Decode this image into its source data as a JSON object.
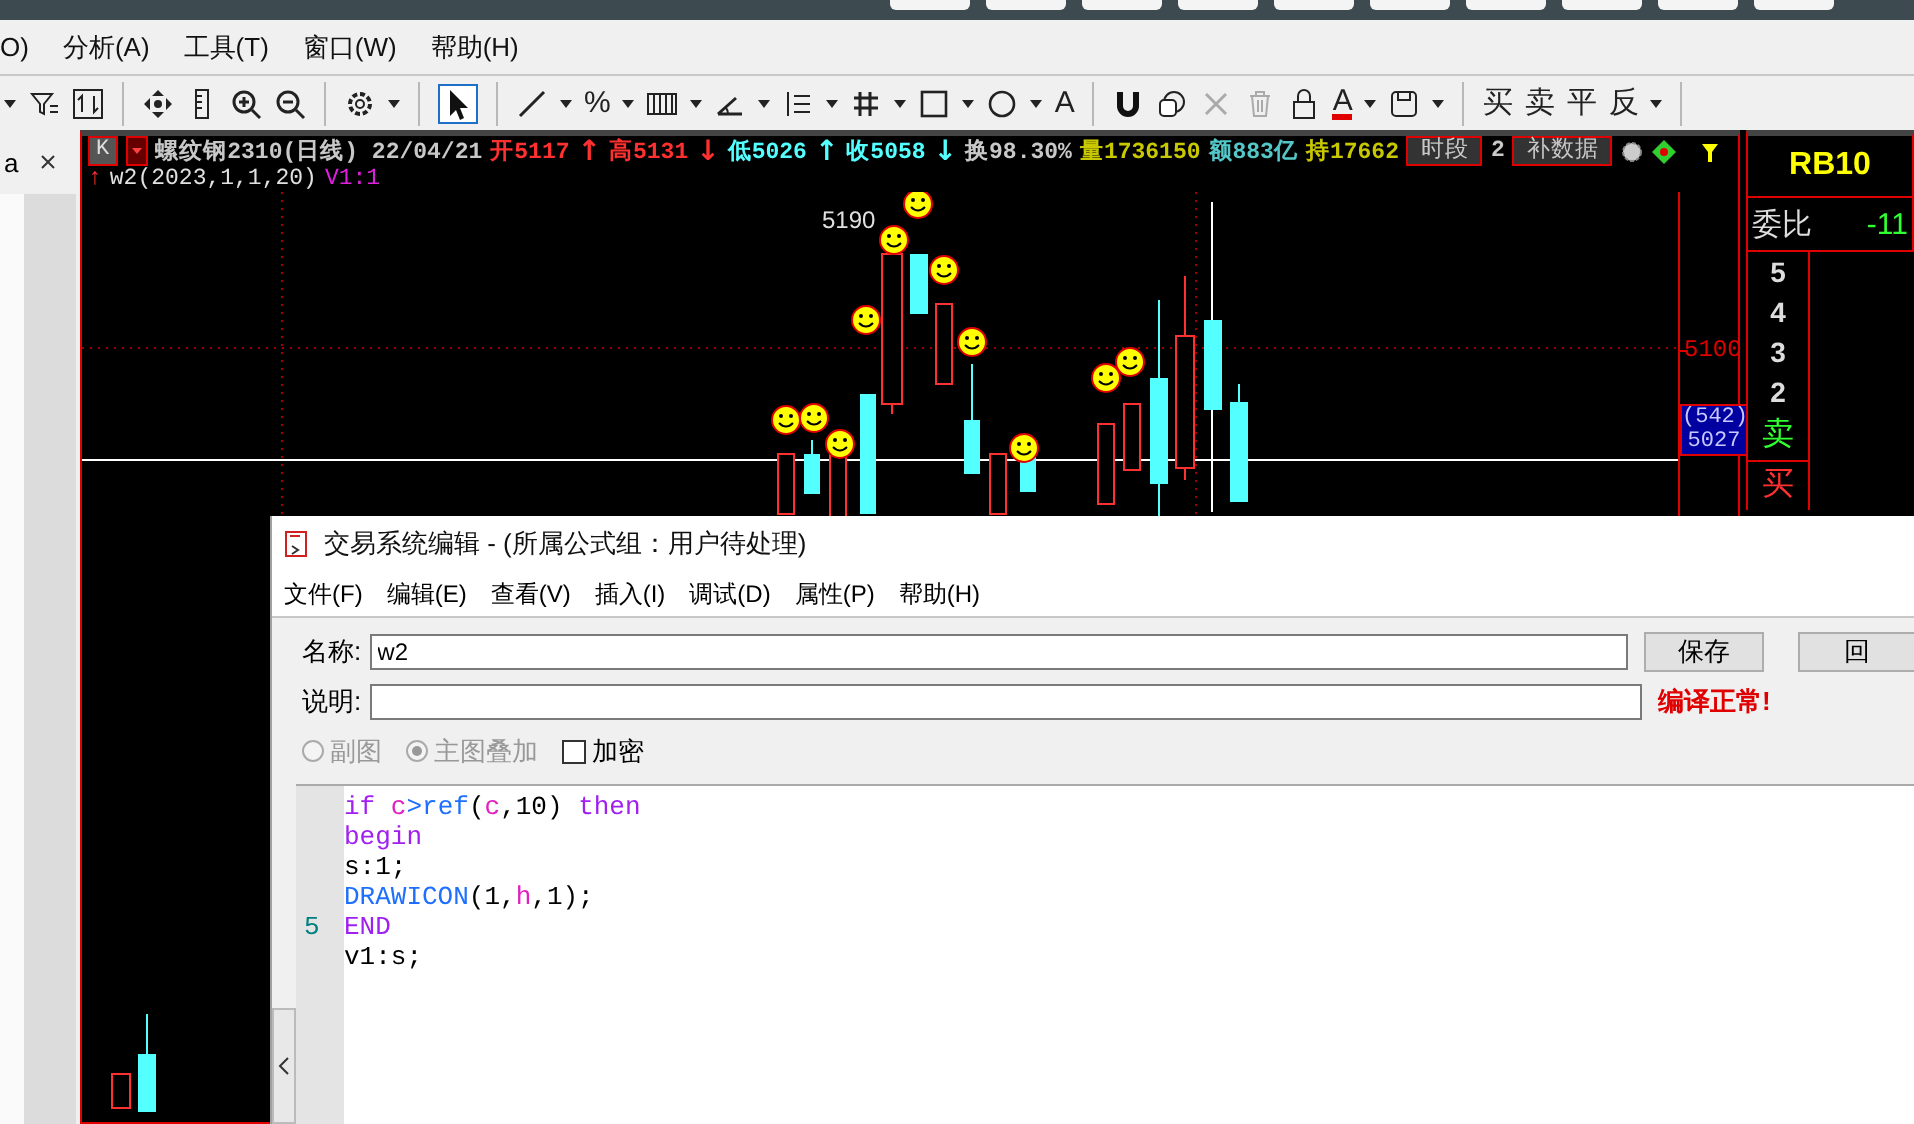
{
  "menu": [
    {
      "label": "O)"
    },
    {
      "label": "分析(A)"
    },
    {
      "label": "工具(T)"
    },
    {
      "label": "窗口(W)"
    },
    {
      "label": "帮助(H)"
    }
  ],
  "toolbar": {
    "labels": [
      "%",
      "A",
      "A",
      "买",
      "卖",
      "平",
      "反"
    ]
  },
  "left_panel": {
    "tab_label": "a"
  },
  "chart": {
    "period_button": "K",
    "quote_items": [
      {
        "kind": "text",
        "text": "螺纹钢2310(日线) 22/04/21",
        "color": "#c8c8c8"
      },
      {
        "kind": "text",
        "text": "开5117",
        "color": "#ff3030"
      },
      {
        "kind": "arrow",
        "text": "↑",
        "color": "#ff3030"
      },
      {
        "kind": "text",
        "text": "高5131",
        "color": "#ff3030"
      },
      {
        "kind": "arrow",
        "text": "↓",
        "color": "#ff3030"
      },
      {
        "kind": "text",
        "text": "低5026",
        "color": "#54ffff"
      },
      {
        "kind": "arrow",
        "text": "↑",
        "color": "#54ffff"
      },
      {
        "kind": "text",
        "text": "收5058",
        "color": "#54ffff"
      },
      {
        "kind": "arrow",
        "text": "↓",
        "color": "#54ffff"
      },
      {
        "kind": "text",
        "text": "换98.30%",
        "color": "#c8c8c8"
      },
      {
        "kind": "text",
        "text": "量1736150",
        "color": "#c8c800"
      },
      {
        "kind": "text",
        "text": "额883亿",
        "color": "#54c8c8"
      },
      {
        "kind": "text",
        "text": "持17662",
        "color": "#c8c800"
      },
      {
        "kind": "button",
        "text": "时段"
      },
      {
        "kind": "text",
        "text": "2",
        "color": "#c8c8c8"
      },
      {
        "kind": "button",
        "text": "补数据"
      }
    ],
    "indicator": {
      "arrow": "↑",
      "label": "w2(2023,1,1,20)",
      "value": "V1:1"
    },
    "peak_label": "5190",
    "axis_label": "5100",
    "crosshair": {
      "count": "(542)",
      "price": "5027"
    }
  },
  "quote_panel": {
    "symbol": "RB10",
    "ratio_label": "委比",
    "ratio_value": "-11",
    "levels": [
      "5",
      "4",
      "3",
      "2"
    ],
    "sell_label": "卖",
    "buy_label": "买"
  },
  "dialog": {
    "title": "交易系统编辑 - (所属公式组：用户待处理)",
    "menu": [
      {
        "label": "文件(F)"
      },
      {
        "label": "编辑(E)"
      },
      {
        "label": "查看(V)"
      },
      {
        "label": "插入(I)"
      },
      {
        "label": "调试(D)"
      },
      {
        "label": "属性(P)"
      },
      {
        "label": "帮助(H)"
      }
    ],
    "name_label": "名称:",
    "name_value": "w2",
    "save_button": "保存",
    "back_button": "回",
    "desc_label": "说明:",
    "status": "编译正常!",
    "options": [
      {
        "kind": "radio",
        "label": "副图",
        "selected": false,
        "disabled": true
      },
      {
        "kind": "radio",
        "label": "主图叠加",
        "selected": true,
        "disabled": true
      },
      {
        "kind": "checkbox",
        "label": "加密",
        "checked": false,
        "disabled": false
      }
    ],
    "code_lines": [
      {
        "tokens": [
          {
            "kind": "keyword",
            "text": "if "
          },
          {
            "kind": "variable",
            "text": "c"
          },
          {
            "kind": "function",
            "text": ">ref"
          },
          {
            "kind": "plain",
            "text": "("
          },
          {
            "kind": "variable",
            "text": "c"
          },
          {
            "kind": "plain",
            "text": ",10) "
          },
          {
            "kind": "keyword",
            "text": "then"
          }
        ]
      },
      {
        "tokens": [
          {
            "kind": "keyword",
            "text": "begin"
          }
        ]
      },
      {
        "tokens": [
          {
            "kind": "plain",
            "text": "s:1;"
          }
        ]
      },
      {
        "tokens": [
          {
            "kind": "function",
            "text": "DRAWICON"
          },
          {
            "kind": "plain",
            "text": "(1,"
          },
          {
            "kind": "variable",
            "text": "h"
          },
          {
            "kind": "plain",
            "text": ",1);"
          }
        ]
      },
      {
        "number": "5",
        "tokens": [
          {
            "kind": "keyword",
            "text": "END"
          }
        ]
      },
      {
        "tokens": [
          {
            "kind": "plain",
            "text": "v1:s;"
          }
        ]
      }
    ]
  }
}
